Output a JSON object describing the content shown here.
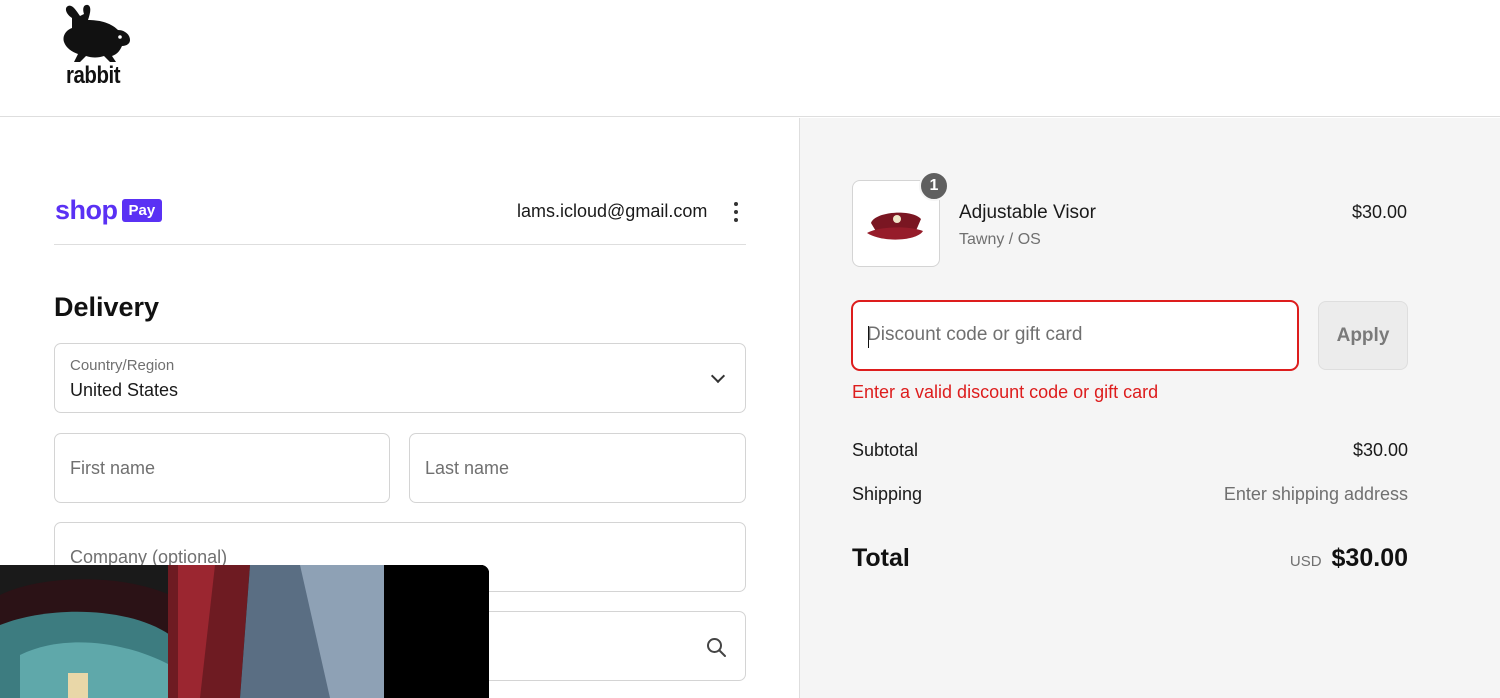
{
  "brand": {
    "name": "rabbit"
  },
  "express": {
    "shop_word": "shop",
    "pay_badge": "Pay",
    "account_email": "lams.icloud@gmail.com"
  },
  "delivery": {
    "title": "Delivery",
    "country_label": "Country/Region",
    "country_value": "United States",
    "first_name_placeholder": "First name",
    "last_name_placeholder": "Last name",
    "company_placeholder": "Company (optional)",
    "address_icon": "search-icon"
  },
  "order": {
    "item": {
      "quantity": "1",
      "name": "Adjustable Visor",
      "variant": "Tawny / OS",
      "price": "$30.00"
    },
    "discount_placeholder": "Discount code or gift card",
    "apply_label": "Apply",
    "error": "Enter a valid discount code or gift card",
    "subtotal_label": "Subtotal",
    "subtotal_value": "$30.00",
    "shipping_label": "Shipping",
    "shipping_value": "Enter shipping address",
    "total_label": "Total",
    "currency": "USD",
    "total_value": "$30.00"
  },
  "colors": {
    "shop_pay": "#5a31f4",
    "error": "#dd1d1d",
    "summary_bg": "#f5f5f5"
  }
}
